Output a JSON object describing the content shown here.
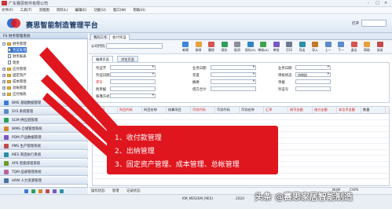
{
  "window": {
    "title": "广东赛思软件有限公司",
    "controls": [
      "-",
      "□",
      "×"
    ]
  },
  "menu": [
    "文件(F)",
    "工具(T)",
    "流程图",
    "资料(L)",
    "编辑(E)",
    "功能(U)",
    "窗口(W)",
    "帮助(H)"
  ],
  "banner": {
    "title": "赛思智能制造管理平台",
    "logout": "打开"
  },
  "sidebar": {
    "header": "FS 财务管理系统",
    "tree": [
      {
        "label": "财务管理",
        "level": 0,
        "kind": "folder",
        "toggle": "−"
      },
      {
        "label": "凭证处理",
        "level": 1,
        "kind": "doc",
        "selected": true
      },
      {
        "label": "财务报表",
        "level": 1,
        "kind": "doc"
      },
      {
        "label": "现金",
        "level": 1,
        "kind": "doc"
      },
      {
        "label": "应付管理",
        "level": 0,
        "kind": "folder",
        "toggle": "+"
      },
      {
        "label": "固定资产",
        "level": 0,
        "kind": "folder",
        "toggle": "+"
      },
      {
        "label": "成本管理",
        "level": 0,
        "kind": "folder",
        "toggle": "+"
      },
      {
        "label": "总账管理",
        "level": 0,
        "kind": "folder",
        "toggle": "+"
      },
      {
        "label": "应付账款",
        "level": 0,
        "kind": "folder",
        "toggle": "+"
      }
    ],
    "systems": [
      {
        "label": "BMS 基础数据管理",
        "color": "#3a7bd5"
      },
      {
        "label": "SYS 系统管理",
        "color": "#5b8bc9"
      },
      {
        "label": "SCM 供应链管理",
        "color": "#2e9e5b"
      },
      {
        "label": "WMS 仓储管理系统",
        "color": "#d7872a"
      },
      {
        "label": "PDM 产品数据管理",
        "color": "#7a56c2"
      },
      {
        "label": "PMS 生产管理系统",
        "color": "#c24a4a"
      },
      {
        "label": "MES 制造执行系统",
        "color": "#2b8fa6"
      },
      {
        "label": "APS 智能排程系统",
        "color": "#6a9a2a"
      },
      {
        "label": "TQM 品质管理系统",
        "color": "#b5649c"
      },
      {
        "label": "HRM 人力资源管理",
        "color": "#4a6fa5"
      }
    ],
    "foot_icons": [
      "#3a7bd5",
      "#2e9e5b",
      "#d7872a",
      "#c24a4a",
      "#7a56c2",
      "#2b8fa6"
    ]
  },
  "tabs": [
    {
      "label": "我的工作",
      "active": false
    },
    {
      "label": "会计凭证",
      "active": true
    }
  ],
  "toolbar": {
    "company_label": "公司代码",
    "buttons": [
      {
        "label": "新增",
        "color": "#3f86d8"
      },
      {
        "label": "修改",
        "color": "#e6a23c"
      },
      {
        "label": "删除",
        "color": "#d9534f"
      },
      {
        "label": "保存",
        "color": "#2e9e5b"
      },
      {
        "label": "取消",
        "color": "#8a8f98"
      },
      {
        "label": "保存(S)",
        "color": "#2e86c1"
      },
      {
        "label": "审核(A)",
        "color": "#3fa34d"
      },
      {
        "label": "审批",
        "color": "#7a56c2"
      },
      {
        "label": "打印",
        "color": "#6b7b8c"
      },
      {
        "label": "导出",
        "color": "#2b8fa6"
      },
      {
        "label": "导入",
        "color": "#c27a2a"
      },
      {
        "label": "上一",
        "color": "#5b8bc9"
      },
      {
        "label": "下一",
        "color": "#5b8bc9"
      },
      {
        "label": "退出",
        "color": "#d9534f"
      },
      {
        "label": "帮助",
        "color": "#e6a23c"
      },
      {
        "label": "关闭",
        "color": "#c24a4a"
      }
    ]
  },
  "subtabs": [
    {
      "label": "编辑页面",
      "active": true
    },
    {
      "label": "浏览页面",
      "active": false
    }
  ],
  "form": {
    "labels": {
      "voucher_word": "凭证字",
      "voucher_no": "凭证日期",
      "seq": "序号",
      "attach": "附单据",
      "period": "业务日期",
      "year": "年度",
      "remark": "摘要",
      "book": "账簿方式",
      "account": "业务日期",
      "status": "审核状态",
      "maker": "单据",
      "total": "借方合计",
      "period2": "会计期间",
      "ref": "凭证号",
      "cur": "凭证类别",
      "amount": "借方金额"
    },
    "values": {
      "status": "待审核"
    }
  },
  "grid": {
    "headers": [
      {
        "label": "分录号",
        "req": true
      },
      {
        "label": "科目代码",
        "req": true
      },
      {
        "label": "科目名称",
        "req": false
      },
      {
        "label": "核算项目",
        "req": false
      },
      {
        "label": "币别代码",
        "req": true
      },
      {
        "label": "币别代码",
        "req": false
      },
      {
        "label": "币别名称",
        "req": false
      },
      {
        "label": "汇率",
        "req": true
      },
      {
        "label": "原币金额",
        "req": true
      },
      {
        "label": "借方金额",
        "req": true
      },
      {
        "label": "本位币金额",
        "req": true
      },
      {
        "label": "数量",
        "req": false
      }
    ]
  },
  "status": {
    "operator_label": "操作状态:",
    "operator": "新增",
    "record": "记录状态:",
    "num": "NUM",
    "caps": "CAPS"
  },
  "bottom": {
    "user": "KM_MES(KM_MES)",
    "date": "2020"
  },
  "callout": [
    "1、收付款管理",
    "2、出纳管理",
    "3、固定资产管理、成本管理、总帐管理"
  ],
  "watermark": "头条 @赛思家居智能制造"
}
